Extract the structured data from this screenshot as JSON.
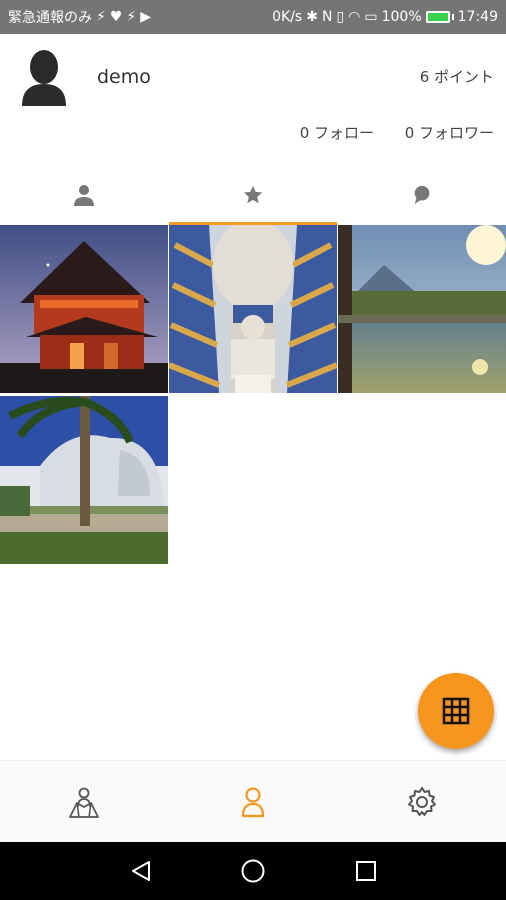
{
  "status_bar": {
    "carrier": "緊急通報のみ",
    "speed": "0K/s",
    "battery": "100%",
    "time": "17:49"
  },
  "profile": {
    "username": "demo",
    "points": "6 ポイント",
    "follow": "0 フォロー",
    "follower": "0 フォロワー"
  },
  "tabs": [
    {
      "icon": "person-icon",
      "active": false
    },
    {
      "icon": "star-icon",
      "active": true
    },
    {
      "icon": "comment-icon",
      "active": false
    }
  ],
  "photos": [
    {
      "subject": "red shrine gate at dusk"
    },
    {
      "subject": "sphinx and pharaoh statue"
    },
    {
      "subject": "mountain reflected in pool at sunset"
    },
    {
      "subject": "modern curved building with palm tree"
    }
  ],
  "bottom_nav": [
    {
      "icon": "map-person-icon",
      "active": false
    },
    {
      "icon": "person-icon",
      "active": true
    },
    {
      "icon": "gear-icon",
      "active": false
    }
  ],
  "colors": {
    "accent": "#f7951d",
    "status_bar": "#757575",
    "active_tab": "#f39c1f"
  }
}
